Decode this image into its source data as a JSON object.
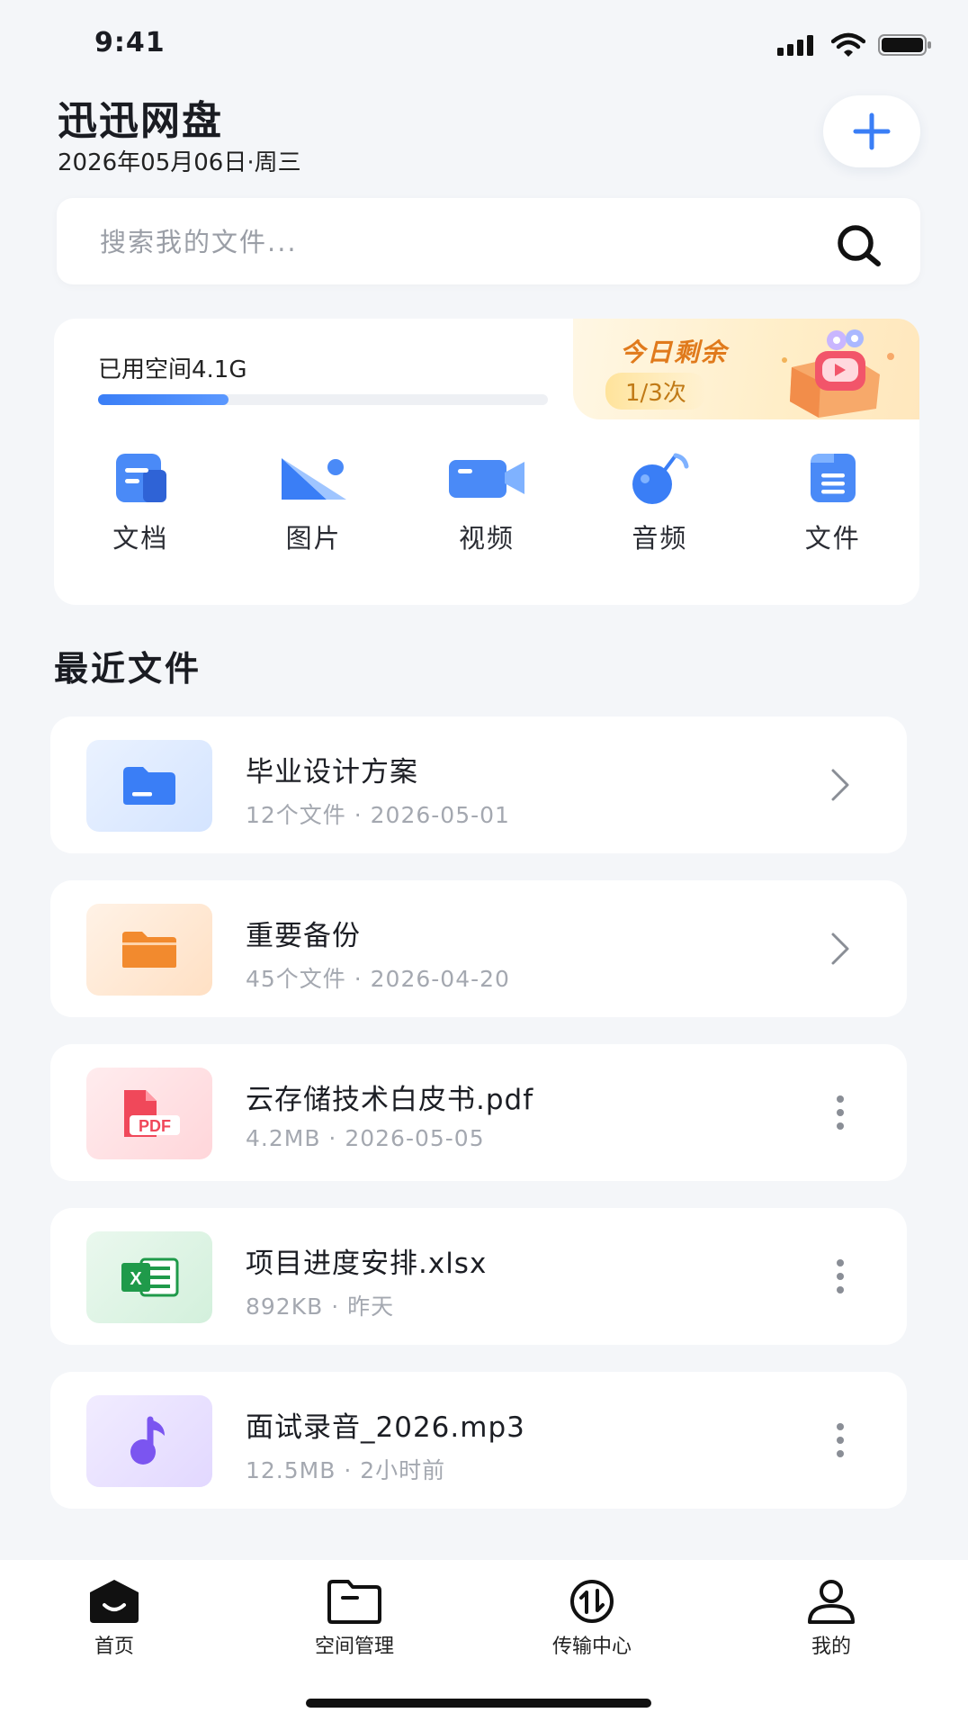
{
  "status_bar": {
    "time": "9:41"
  },
  "header": {
    "title": "迅迅网盘",
    "date": "2026年05月06日·周三"
  },
  "search": {
    "placeholder": "搜索我的文件..."
  },
  "storage": {
    "used_label": "已用空间4.1G",
    "used_fraction": 0.29,
    "promo_title": "今日剩余",
    "promo_count": "1/3次"
  },
  "categories": [
    {
      "label": "文档",
      "icon": "document-icon"
    },
    {
      "label": "图片",
      "icon": "image-icon"
    },
    {
      "label": "视频",
      "icon": "video-icon"
    },
    {
      "label": "音频",
      "icon": "audio-icon"
    },
    {
      "label": "文件",
      "icon": "file-icon"
    }
  ],
  "recent": {
    "title": "最近文件",
    "items": [
      {
        "name": "毕业设计方案",
        "meta": "12个文件 · 2026-05-01",
        "icon": "folder-blue-icon",
        "action": "chevron-right-icon"
      },
      {
        "name": "重要备份",
        "meta": "45个文件 · 2026-04-20",
        "icon": "folder-orange-icon",
        "action": "chevron-right-icon"
      },
      {
        "name": "云存储技术白皮书.pdf",
        "meta": "4.2MB · 2026-05-05",
        "icon": "pdf-icon",
        "action": "more-icon"
      },
      {
        "name": "项目进度安排.xlsx",
        "meta": "892KB · 昨天",
        "icon": "excel-icon",
        "action": "more-icon"
      },
      {
        "name": "面试录音_2026.mp3",
        "meta": "12.5MB · 2小时前",
        "icon": "music-icon",
        "action": "more-icon"
      }
    ]
  },
  "tabbar": [
    {
      "label": "首页",
      "icon": "home-icon"
    },
    {
      "label": "空间管理",
      "icon": "folder-manage-icon"
    },
    {
      "label": "传输中心",
      "icon": "transfer-icon"
    },
    {
      "label": "我的",
      "icon": "user-icon"
    }
  ],
  "colors": {
    "accent": "#3a7ef6",
    "background": "#f4f6f9",
    "promo": "#e07a1c"
  }
}
